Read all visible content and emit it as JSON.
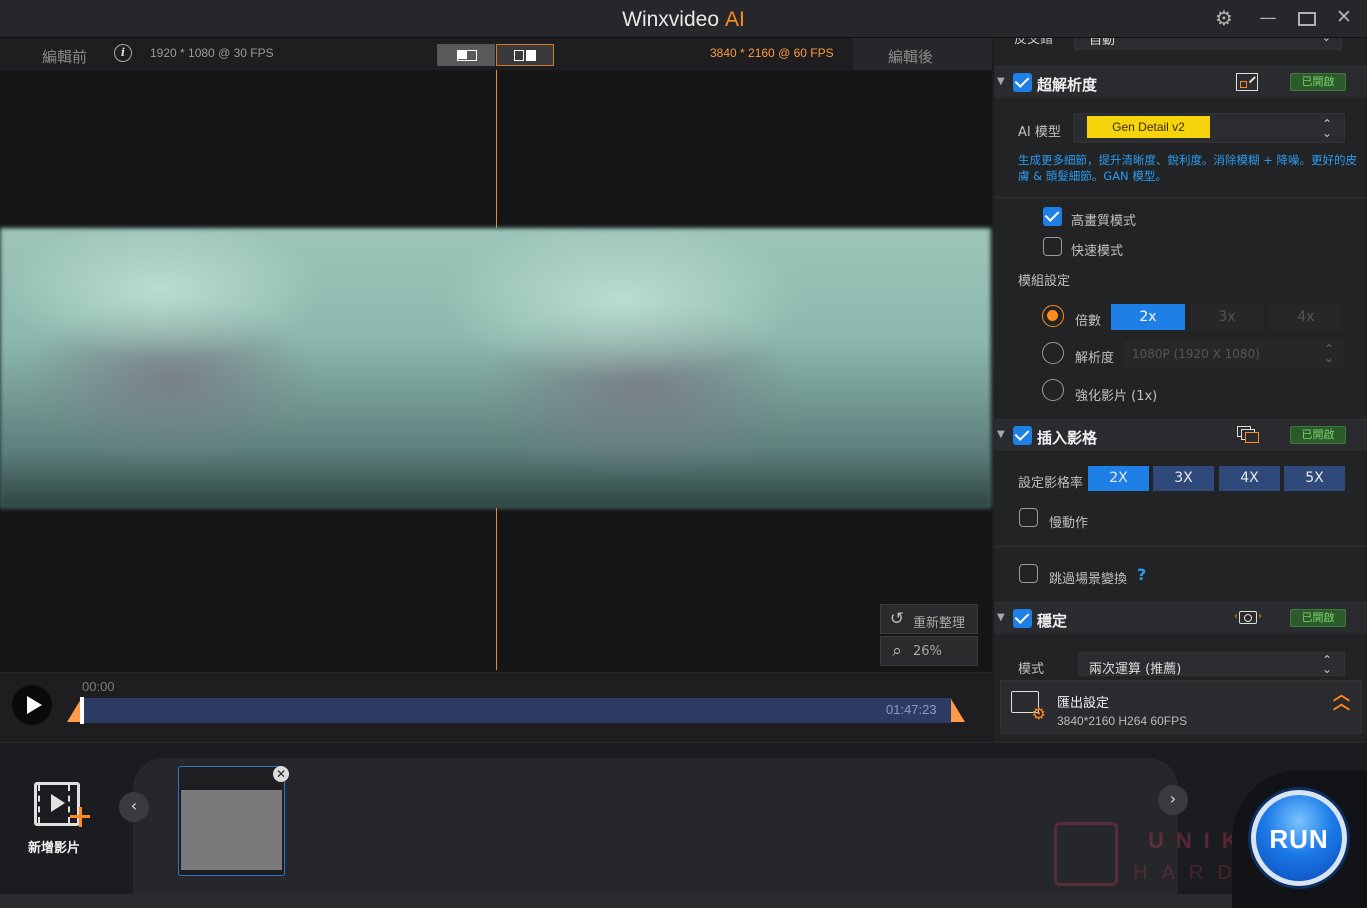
{
  "app": {
    "title": "Winxvideo",
    "title_accent": "AI"
  },
  "preview": {
    "before_label": "編輯前",
    "after_label": "編輯後",
    "source_info": "1920 * 1080 @ 30 FPS",
    "output_info": "3840 * 2160 @ 60 FPS",
    "reset_label": "重新整理",
    "zoom_label": "26%"
  },
  "timeline": {
    "start": "00:00",
    "end": "01:47:23"
  },
  "panel": {
    "top_row": {
      "label": "反交錯",
      "value": "自動"
    },
    "super_resolution": {
      "title": "超解析度",
      "badge": "已開啟",
      "ai_model_label": "AI 模型",
      "ai_model_value": "Gen Detail v2",
      "description": "生成更多細節，提升清晰度、銳利度。消除模糊 + 降噪。更好的皮膚 & 頭髮細節。GAN 模型。",
      "high_quality": "高畫質模式",
      "fast_mode": "快速模式",
      "module_settings": "模組設定",
      "scale_label": "倍數",
      "scale_options": [
        "2x",
        "3x",
        "4x"
      ],
      "resolution_label": "解析度",
      "resolution_value": "1080P (1920 X 1080)",
      "enhance_label": "強化影片 (1x)"
    },
    "frame_interp": {
      "title": "插入影格",
      "badge": "已開啟",
      "rate_label": "設定影格率",
      "rate_options": [
        "2X",
        "3X",
        "4X",
        "5X"
      ],
      "slow_motion": "慢動作",
      "skip_scene": "跳過場景變換",
      "help": "?"
    },
    "stabilize": {
      "title": "穩定",
      "badge": "已開啟",
      "mode_label": "模式",
      "mode_value": "兩次運算 (推薦)"
    },
    "export": {
      "title": "匯出設定",
      "details": "3840*2160  H264  60FPS"
    }
  },
  "bottom": {
    "add_video": "新增影片",
    "run": "RUN",
    "watermark_line1": "UNIKO",
    "watermark_line2": "HARDWARE"
  },
  "colors": {
    "accent_orange": "#ff8a1f",
    "accent_blue": "#1e7fe6",
    "badge_green": "#7ad36a"
  }
}
